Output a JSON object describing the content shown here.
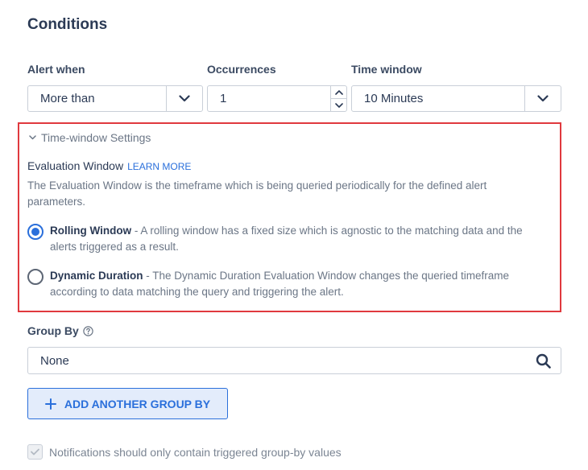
{
  "conditions": {
    "title": "Conditions",
    "alert_when": {
      "label": "Alert when",
      "value": "More than"
    },
    "occurrences": {
      "label": "Occurrences",
      "value": "1"
    },
    "time_window": {
      "label": "Time window",
      "value": "10 Minutes"
    }
  },
  "time_window_settings": {
    "toggle_label": "Time-window Settings",
    "evaluation_title": "Evaluation Window",
    "learn_more": "LEARN MORE",
    "evaluation_description": "The Evaluation Window is the timeframe which is being queried periodically for the defined alert parameters.",
    "options": [
      {
        "name": "Rolling Window",
        "separator": " - ",
        "description": "A rolling window has a fixed size which is agnostic to the matching data and the alerts triggered as a result.",
        "selected": true
      },
      {
        "name": "Dynamic Duration",
        "separator": " - ",
        "description": "The Dynamic Duration Evaluation Window changes the queried timeframe according to data matching the query and triggering the alert.",
        "selected": false
      }
    ]
  },
  "group_by": {
    "label": "Group By",
    "value": "None",
    "add_button": "ADD ANOTHER GROUP BY"
  },
  "notifications": {
    "label": "Notifications should only contain triggered group-by values",
    "checked": true
  },
  "colors": {
    "accent": "#2a6fdb",
    "highlight_border": "#e0393e",
    "text_dark": "#2b3a55",
    "text_muted": "#6b7686"
  }
}
